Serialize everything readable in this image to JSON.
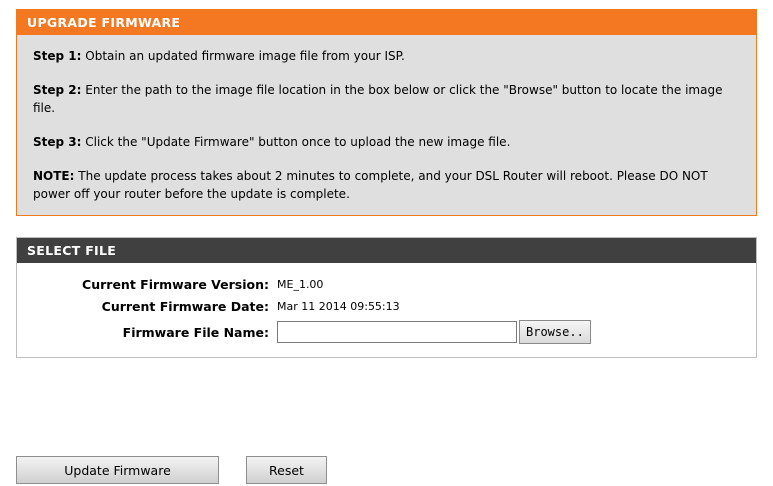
{
  "upgrade": {
    "title": "UPGRADE FIRMWARE",
    "step1_label": "Step 1:",
    "step1_text": " Obtain an updated firmware image file from your ISP.",
    "step2_label": "Step 2:",
    "step2_text": " Enter the path to the image file location in the box below or click the \"Browse\" button to locate the image file.",
    "step3_label": "Step 3:",
    "step3_text": " Click the \"Update Firmware\" button once to upload the new image file.",
    "note_label": "NOTE:",
    "note_text": " The update process takes about 2 minutes to complete, and your DSL Router will reboot. Please DO NOT power off your router before the update is complete."
  },
  "select_file": {
    "title": "SELECT FILE",
    "version_label": "Current Firmware Version:",
    "version_value": "ME_1.00",
    "date_label": "Current Firmware Date:",
    "date_value": "Mar 11 2014 09:55:13",
    "file_label": "Firmware File Name:",
    "file_value": "",
    "browse_label": "Browse.."
  },
  "actions": {
    "update_label": "Update Firmware",
    "reset_label": "Reset"
  },
  "colors": {
    "orange_header": "#f47721",
    "dark_header": "#404040",
    "panel_bg": "#dfdfdf"
  }
}
